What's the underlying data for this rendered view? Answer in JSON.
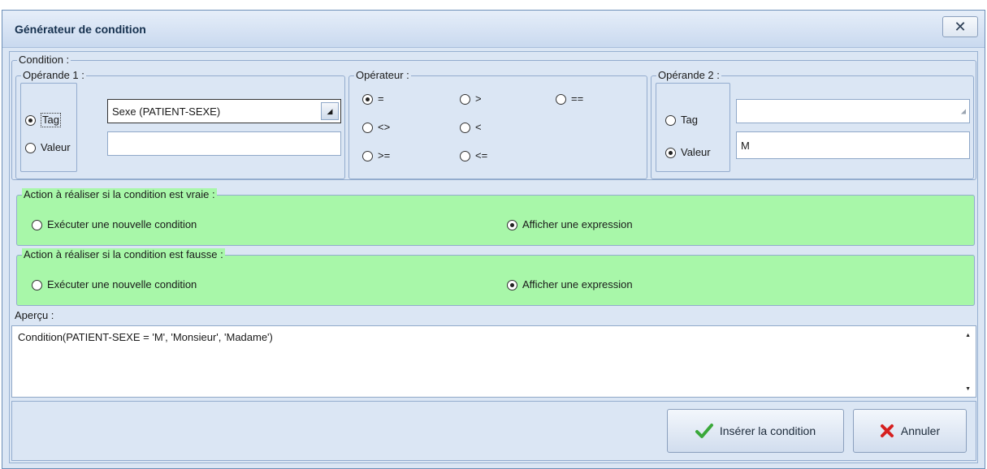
{
  "window": {
    "title": "Générateur de condition",
    "close_label": "✕"
  },
  "condition": {
    "legend": "Condition :",
    "operand1": {
      "legend": "Opérande 1 :",
      "tag_label": "Tag",
      "value_label": "Valeur",
      "selected": "tag",
      "tag_value": "Sexe (PATIENT-SEXE)",
      "value_input": ""
    },
    "operator": {
      "legend": "Opérateur :",
      "options": [
        "=",
        ">",
        "==",
        "<>",
        "<",
        ">=",
        "<="
      ],
      "selected": "="
    },
    "operand2": {
      "legend": "Opérande 2 :",
      "tag_label": "Tag",
      "value_label": "Valeur",
      "selected": "value",
      "tag_value": "",
      "value_input": "M"
    }
  },
  "action_true": {
    "legend": "Action à réaliser si la condition est vraie :",
    "option1": "Exécuter une nouvelle condition",
    "option2": "Afficher une expression",
    "selected": "option2"
  },
  "action_false": {
    "legend": "Action à réaliser si la condition est fausse :",
    "option1": "Exécuter une nouvelle condition",
    "option2": "Afficher une expression",
    "selected": "option2"
  },
  "preview": {
    "label": "Aperçu :",
    "text": "Condition(PATIENT-SEXE = 'M', 'Monsieur', 'Madame')"
  },
  "buttons": {
    "insert_label": "Insérer la condition",
    "cancel_label": "Annuler"
  },
  "colors": {
    "green_panel": "#a8f7a9",
    "dialog_bg": "#dbe6f4",
    "check_icon": "#3aa83a",
    "cancel_icon": "#d62020"
  }
}
